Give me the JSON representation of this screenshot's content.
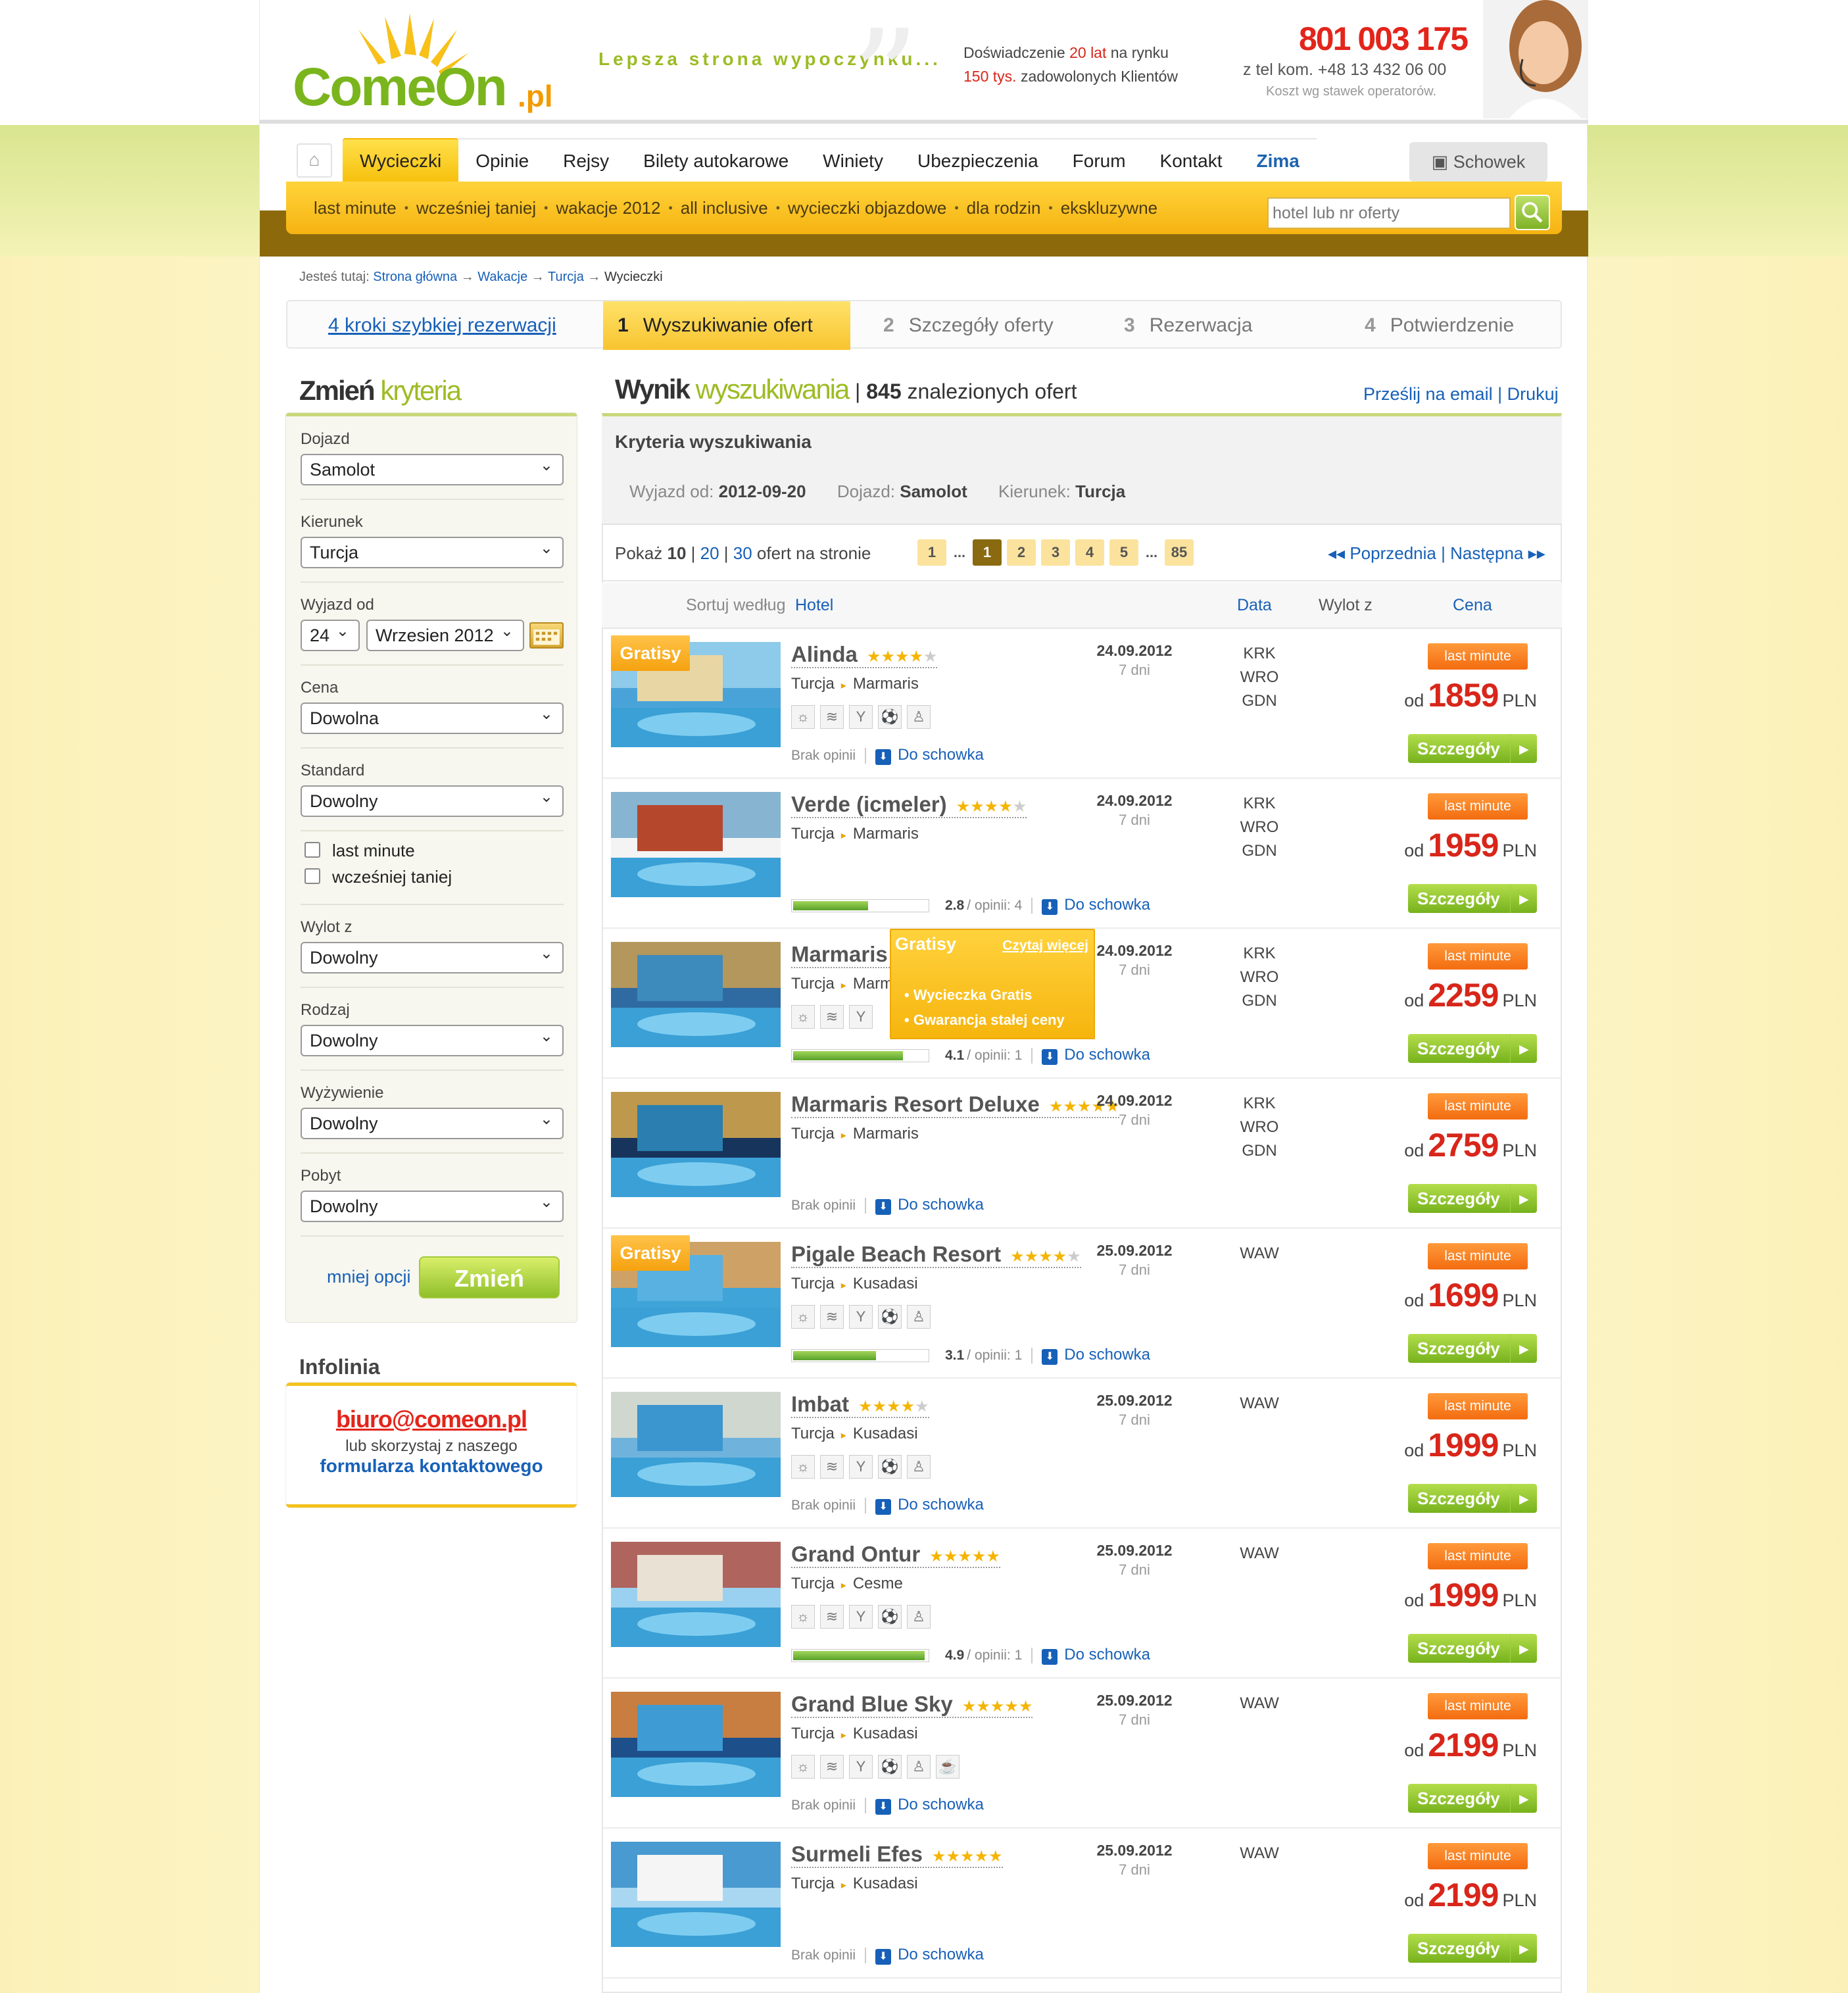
{
  "header": {
    "logo_text": "ComeOn.pl",
    "slogan": "Lepsza strona wypoczynku...",
    "exp_line1_a": "Doświadczenie",
    "exp_line1_b": "20 lat",
    "exp_line1_c": "na rynku",
    "exp_line2_a": "150 tys.",
    "exp_line2_b": "zadowolonych Klientów",
    "phone": "801 003 175",
    "phone2": "z tel kom. +48 13 432 06 00",
    "phone3": "Koszt wg stawek operatorów."
  },
  "nav": {
    "items": [
      "Wycieczki",
      "Opinie",
      "Rejsy",
      "Bilety autokarowe",
      "Winiety",
      "Ubezpieczenia",
      "Forum",
      "Kontakt",
      "Zima"
    ],
    "schowek": "Schowek",
    "sub": [
      "last minute",
      "wcześniej taniej",
      "wakacje 2012",
      "all inclusive",
      "wycieczki objazdowe",
      "dla rodzin",
      "ekskluzywne"
    ],
    "search_placeholder": "hotel lub nr oferty"
  },
  "breadcrumb": {
    "prefix": "Jesteś tutaj:",
    "items": [
      "Strona główna",
      "Wakacje",
      "Turcja",
      "Wycieczki"
    ]
  },
  "steps": {
    "intro": "4 kroki szybkiej rezerwacji",
    "items": [
      {
        "num": "1",
        "label": "Wyszukiwanie ofert"
      },
      {
        "num": "2",
        "label": "Szczegóły oferty"
      },
      {
        "num": "3",
        "label": "Rezerwacja"
      },
      {
        "num": "4",
        "label": "Potwierdzenie"
      }
    ]
  },
  "sidebar": {
    "title_a": "Zmień",
    "title_b": "kryteria",
    "fields": [
      {
        "label": "Dojazd",
        "value": "Samolot"
      },
      {
        "label": "Kierunek",
        "value": "Turcja"
      },
      {
        "label": "Wyjazd od",
        "day": "24",
        "month": "Wrzesien 2012"
      },
      {
        "label": "Cena",
        "value": "Dowolna"
      },
      {
        "label": "Standard",
        "value": "Dowolny"
      },
      {
        "label": "Wylot z",
        "value": "Dowolny"
      },
      {
        "label": "Rodzaj",
        "value": "Dowolny"
      },
      {
        "label": "Wyżywienie",
        "value": "Dowolny"
      },
      {
        "label": "Pobyt",
        "value": "Dowolny"
      }
    ],
    "checkboxes": [
      "last minute",
      "wcześniej taniej"
    ],
    "less": "mniej opcji",
    "submit": "Zmień",
    "info_title": "Infolinia",
    "info_mail": "biuro@comeon.pl",
    "info_l2": "lub skorzystaj z naszego",
    "info_l3": "formularza kontaktowego"
  },
  "results": {
    "title_a": "Wynik",
    "title_b": "wyszukiwania",
    "count": "845",
    "count_suffix": "znalezionych ofert",
    "email": "Prześlij na email",
    "print": "Drukuj",
    "criteria_title": "Kryteria wyszukiwania",
    "crit": [
      {
        "k": "Wyjazd od:",
        "v": "2012-09-20"
      },
      {
        "k": "Dojazd:",
        "v": "Samolot"
      },
      {
        "k": "Kierunek:",
        "v": "Turcja"
      }
    ],
    "show_prefix": "Pokaż",
    "show_opts": [
      "10",
      "20",
      "30"
    ],
    "show_suffix": "ofert na stronie",
    "pages": [
      "1",
      "...",
      "1",
      "2",
      "3",
      "4",
      "5",
      "...",
      "85"
    ],
    "prev": "Poprzednia",
    "next": "Następna",
    "sort_label": "Sortuj według",
    "sort_hotel": "Hotel",
    "col_date": "Data",
    "col_from": "Wylot z",
    "col_price": "Cena",
    "popup": {
      "title": "Gratisy",
      "more": "Czytaj więcej",
      "items": [
        "Wycieczka Gratis",
        "Gwarancja stałej ceny"
      ]
    }
  },
  "offers": [
    {
      "name": "Alinda",
      "stars": 4,
      "country": "Turcja",
      "city": "Marmaris",
      "gratisy": "Gratisy",
      "rating": null,
      "reviews": "Brak opinii",
      "date": "24.09.2012",
      "days": "7 dni",
      "from": [
        "KRK",
        "WRO",
        "GDN"
      ],
      "badge": "last minute",
      "price": "1859",
      "icons": 5
    },
    {
      "name": "Verde (icmeler)",
      "stars": 4,
      "country": "Turcja",
      "city": "Marmaris",
      "gratisy": null,
      "rating": "2.8",
      "rating_pct": 56,
      "reviews": "opinii: 4",
      "date": "24.09.2012",
      "days": "7 dni",
      "from": [
        "KRK",
        "WRO",
        "GDN"
      ],
      "badge": "last minute",
      "price": "1959",
      "icons": 0
    },
    {
      "name": "Marmaris Resort",
      "stars": 5,
      "country": "Turcja",
      "city": "Marmaris",
      "gratisy": null,
      "rating": "4.1",
      "rating_pct": 82,
      "reviews": "opinii: 1",
      "date": "24.09.2012",
      "days": "7 dni",
      "from": [
        "KRK",
        "WRO",
        "GDN"
      ],
      "badge": "last minute",
      "price": "2259",
      "icons": 3
    },
    {
      "name": "Marmaris Resort Deluxe",
      "stars": 5,
      "country": "Turcja",
      "city": "Marmaris",
      "gratisy": null,
      "rating": null,
      "reviews": "Brak opinii",
      "date": "24.09.2012",
      "days": "7 dni",
      "from": [
        "KRK",
        "WRO",
        "GDN"
      ],
      "badge": "last minute",
      "price": "2759",
      "icons": 0
    },
    {
      "name": "Pigale Beach Resort",
      "stars": 4,
      "country": "Turcja",
      "city": "Kusadasi",
      "gratisy": "Gratisy",
      "rating": "3.1",
      "rating_pct": 62,
      "reviews": "opinii: 1",
      "date": "25.09.2012",
      "days": "7 dni",
      "from": [
        "WAW"
      ],
      "badge": "last minute",
      "price": "1699",
      "icons": 5
    },
    {
      "name": "Imbat",
      "stars": 4,
      "country": "Turcja",
      "city": "Kusadasi",
      "gratisy": null,
      "rating": null,
      "reviews": "Brak opinii",
      "date": "25.09.2012",
      "days": "7 dni",
      "from": [
        "WAW"
      ],
      "badge": "last minute",
      "price": "1999",
      "icons": 5
    },
    {
      "name": "Grand Ontur",
      "stars": 5,
      "country": "Turcja",
      "city": "Cesme",
      "gratisy": null,
      "rating": "4.9",
      "rating_pct": 98,
      "reviews": "opinii: 1",
      "date": "25.09.2012",
      "days": "7 dni",
      "from": [
        "WAW"
      ],
      "badge": "last minute",
      "price": "1999",
      "icons": 5
    },
    {
      "name": "Grand Blue Sky",
      "stars": 5,
      "country": "Turcja",
      "city": "Kusadasi",
      "gratisy": null,
      "rating": null,
      "reviews": "Brak opinii",
      "date": "25.09.2012",
      "days": "7 dni",
      "from": [
        "WAW"
      ],
      "badge": "last minute",
      "price": "2199",
      "icons": 6
    },
    {
      "name": "Surmeli Efes",
      "stars": 5,
      "country": "Turcja",
      "city": "Kusadasi",
      "gratisy": null,
      "rating": null,
      "reviews": "Brak opinii",
      "date": "25.09.2012",
      "days": "7 dni",
      "from": [
        "WAW"
      ],
      "badge": "last minute",
      "price": "2199",
      "icons": 0
    }
  ],
  "labels": {
    "od": "od",
    "pln": "PLN",
    "do_schowka": "Do schowka",
    "szczegoly": "Szczegóły",
    "rating_sep": "/"
  }
}
